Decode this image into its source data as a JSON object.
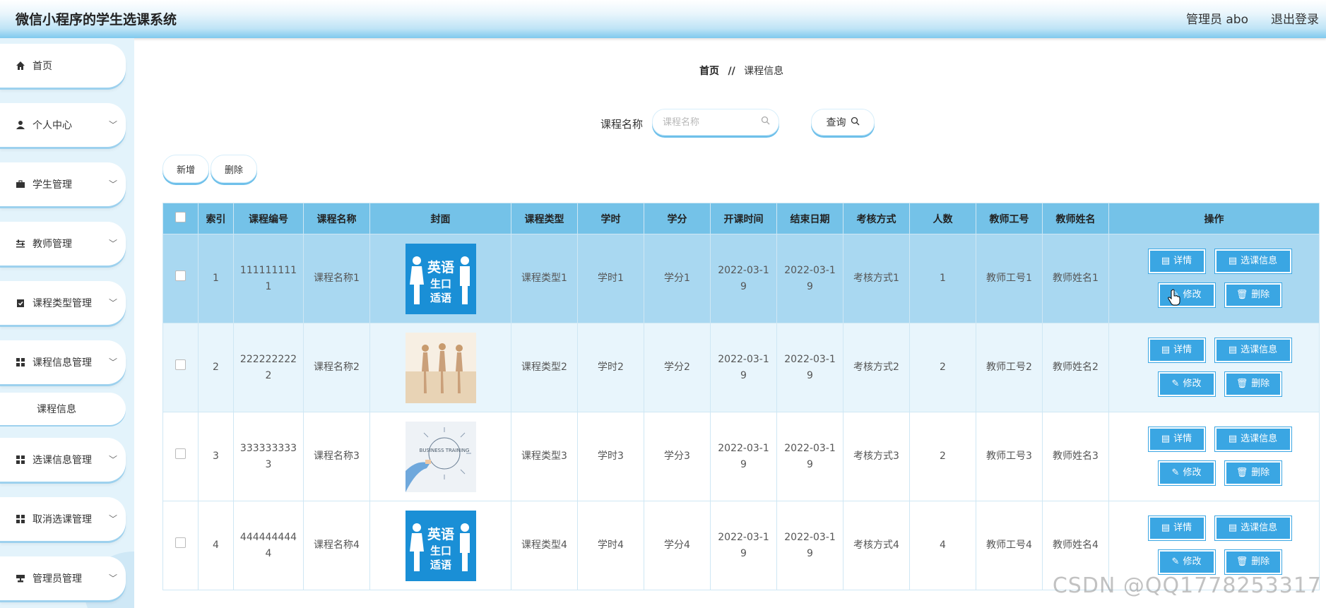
{
  "header": {
    "app_title": "微信小程序的学生选课系统",
    "admin_label": "管理员 abo",
    "logout": "退出登录"
  },
  "sidebar": {
    "items": [
      {
        "label": "首页",
        "icon": "home-icon",
        "expandable": false
      },
      {
        "label": "个人中心",
        "icon": "user-icon",
        "expandable": true
      },
      {
        "label": "学生管理",
        "icon": "briefcase-icon",
        "expandable": true
      },
      {
        "label": "教师管理",
        "icon": "sliders-icon",
        "expandable": true
      },
      {
        "label": "课程类型管理",
        "icon": "clipboard-icon",
        "expandable": true
      },
      {
        "label": "课程信息管理",
        "icon": "grid-icon",
        "expandable": true
      },
      {
        "label": "选课信息管理",
        "icon": "grid-icon",
        "expandable": true
      },
      {
        "label": "取消选课管理",
        "icon": "grid-icon",
        "expandable": true
      },
      {
        "label": "管理员管理",
        "icon": "stamp-icon",
        "expandable": true
      }
    ],
    "active_subitem": "课程信息"
  },
  "breadcrumb": {
    "home": "首页",
    "separator": "//",
    "current": "课程信息"
  },
  "search": {
    "label": "课程名称",
    "placeholder": "课程名称",
    "value": "",
    "button": "查询"
  },
  "actions": {
    "add": "新增",
    "delete": "删除"
  },
  "table": {
    "columns": [
      "索引",
      "课程编号",
      "课程名称",
      "封面",
      "课程类型",
      "学时",
      "学分",
      "开课时间",
      "结束日期",
      "考核方式",
      "人数",
      "教师工号",
      "教师姓名",
      "操作"
    ],
    "rows": [
      {
        "index": "1",
        "code": "1111111111",
        "name": "课程名称1",
        "cover": "english-cover",
        "type": "课程类型1",
        "hours": "学时1",
        "credit": "学分1",
        "start": "2022-03-19",
        "end": "2022-03-19",
        "exam": "考核方式1",
        "count": "1",
        "teacher_id": "教师工号1",
        "teacher_name": "教师姓名1"
      },
      {
        "index": "2",
        "code": "2222222222",
        "name": "课程名称2",
        "cover": "dance-cover",
        "type": "课程类型2",
        "hours": "学时2",
        "credit": "学分2",
        "start": "2022-03-19",
        "end": "2022-03-19",
        "exam": "考核方式2",
        "count": "2",
        "teacher_id": "教师工号2",
        "teacher_name": "教师姓名2"
      },
      {
        "index": "3",
        "code": "3333333333",
        "name": "课程名称3",
        "cover": "training-cover",
        "type": "课程类型3",
        "hours": "学时3",
        "credit": "学分3",
        "start": "2022-03-19",
        "end": "2022-03-19",
        "exam": "考核方式3",
        "count": "2",
        "teacher_id": "教师工号3",
        "teacher_name": "教师姓名3"
      },
      {
        "index": "4",
        "code": "4444444444",
        "name": "课程名称4",
        "cover": "english-cover",
        "type": "课程类型4",
        "hours": "学时4",
        "credit": "学分4",
        "start": "2022-03-19",
        "end": "2022-03-19",
        "exam": "考核方式4",
        "count": "4",
        "teacher_id": "教师工号4",
        "teacher_name": "教师姓名4"
      }
    ],
    "row_actions": {
      "detail": "详情",
      "select_info": "选课信息",
      "edit": "修改",
      "delete": "删除"
    }
  },
  "cover_text": {
    "english": "英语",
    "line2": "生口",
    "line3": "适语",
    "training": "BUSINESS TRAINING"
  },
  "watermark": "CSDN @QQ1778253317",
  "colors": {
    "accent": "#3aa6e3",
    "header_row": "#74c2e8",
    "selected_row": "#a9d8f1",
    "alt_row": "#e8f5fc"
  }
}
